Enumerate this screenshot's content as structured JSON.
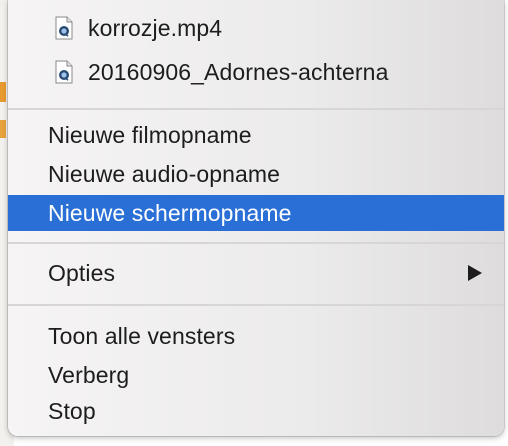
{
  "recent_files": [
    {
      "name": "korrozje.mp4",
      "icon": "quicktime-file-icon"
    },
    {
      "name": "20160906_Adornes-achterna",
      "icon": "quicktime-file-icon"
    }
  ],
  "actions": [
    {
      "label": "Nieuwe filmopname",
      "selected": false
    },
    {
      "label": "Nieuwe audio-opname",
      "selected": false
    },
    {
      "label": "Nieuwe schermopname",
      "selected": true
    }
  ],
  "options": {
    "label": "Opties",
    "has_submenu": true
  },
  "app_items": [
    {
      "label": "Toon alle vensters"
    },
    {
      "label": "Verberg"
    },
    {
      "label": "Stop"
    }
  ],
  "colors": {
    "selection": "#2a6fd6",
    "text": "#1d1d1d",
    "menu_bg": "#f0eeee"
  }
}
